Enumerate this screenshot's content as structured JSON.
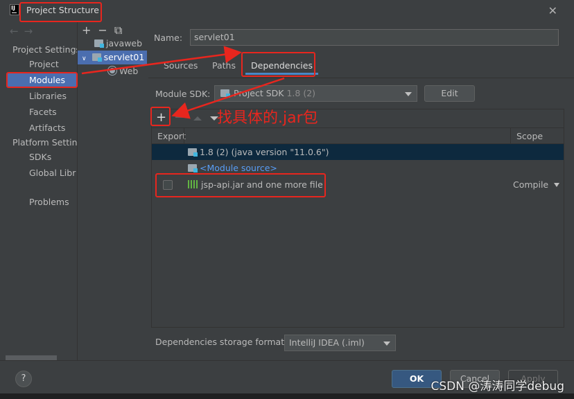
{
  "window": {
    "title": "Project Structure",
    "logo_text": "IJ"
  },
  "nav": {
    "project_settings_label": "Project Settings",
    "project_settings_items": [
      "Project",
      "Modules",
      "Libraries",
      "Facets",
      "Artifacts"
    ],
    "platform_settings_label": "Platform Settings",
    "platform_settings_items": [
      "SDKs",
      "Global Libraries"
    ],
    "problems_label": "Problems",
    "selected": "Modules"
  },
  "tree": {
    "items": [
      {
        "label": "javaweb",
        "icon": "module-folder-icon"
      },
      {
        "label": "servlet01",
        "icon": "module-folder-icon",
        "selected": true
      },
      {
        "label": "Web",
        "icon": "web-facet-icon"
      }
    ]
  },
  "module": {
    "name_label": "Name:",
    "name_value": "servlet01",
    "tabs": [
      "Sources",
      "Paths",
      "Dependencies"
    ],
    "active_tab": "Dependencies",
    "sdk_label": "Module SDK:",
    "sdk_value": "Project SDK",
    "sdk_version": "1.8 (2)",
    "edit_label": "Edit",
    "columns": {
      "export": "Export",
      "scope": "Scope"
    },
    "dependencies": [
      {
        "label": "1.8 (2)",
        "suffix": " (java version \"11.0.6\")",
        "selected": true
      },
      {
        "label": "<Module source>"
      },
      {
        "label": "jsp-api.jar and one more file",
        "scope": "Compile"
      }
    ],
    "storage_label": "Dependencies storage format:",
    "storage_value": "IntelliJ IDEA (.iml)"
  },
  "buttons": {
    "help": "?",
    "ok": "OK",
    "cancel": "Cancel",
    "apply": "Apply"
  },
  "annotation": {
    "text": "找具体的.jar包",
    "color": "#e8261e"
  },
  "watermark": "CSDN @涛涛同学debug"
}
